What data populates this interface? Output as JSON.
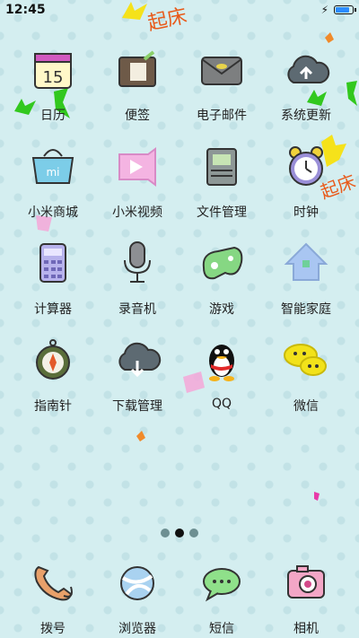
{
  "status_bar": {
    "time": "12:45",
    "battery_level": 0.9
  },
  "apps": [
    {
      "label": "日历",
      "icon": "calendar-icon",
      "badge": "15"
    },
    {
      "label": "便签",
      "icon": "notes-icon"
    },
    {
      "label": "电子邮件",
      "icon": "email-icon"
    },
    {
      "label": "系统更新",
      "icon": "update-cloud-icon"
    },
    {
      "label": "小米商城",
      "icon": "shop-bag-icon"
    },
    {
      "label": "小米视频",
      "icon": "video-icon"
    },
    {
      "label": "文件管理",
      "icon": "file-manager-icon"
    },
    {
      "label": "时钟",
      "icon": "alarm-clock-icon"
    },
    {
      "label": "计算器",
      "icon": "calculator-icon"
    },
    {
      "label": "录音机",
      "icon": "microphone-icon"
    },
    {
      "label": "游戏",
      "icon": "gamepad-icon"
    },
    {
      "label": "智能家庭",
      "icon": "smart-home-icon"
    },
    {
      "label": "指南针",
      "icon": "compass-icon"
    },
    {
      "label": "下载管理",
      "icon": "download-cloud-icon"
    },
    {
      "label": "QQ",
      "icon": "qq-penguin-icon"
    },
    {
      "label": "微信",
      "icon": "wechat-icon"
    }
  ],
  "page_indicator": {
    "pages": 3,
    "current": 2
  },
  "dock": [
    {
      "label": "拨号",
      "icon": "phone-icon"
    },
    {
      "label": "浏览器",
      "icon": "browser-icon"
    },
    {
      "label": "短信",
      "icon": "message-icon"
    },
    {
      "label": "相机",
      "icon": "camera-icon"
    }
  ],
  "wallpaper": {
    "decor_text": "起床"
  }
}
